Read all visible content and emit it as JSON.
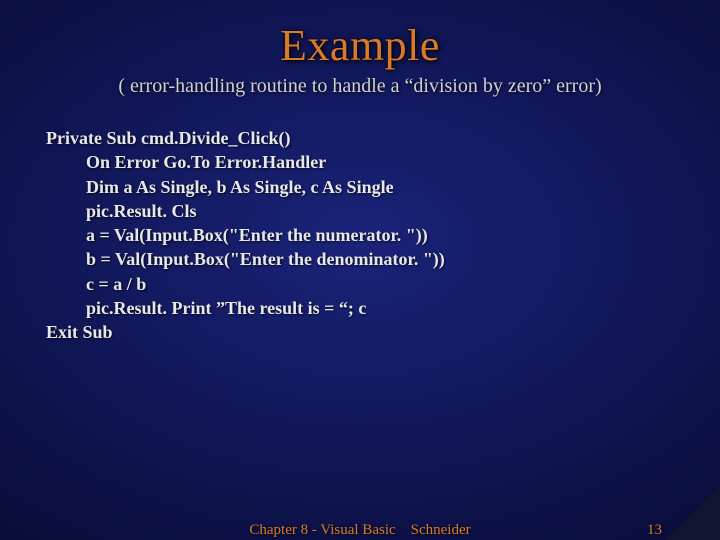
{
  "title": "Example",
  "subtitle": "( error-handling routine to handle a “division by zero” error)",
  "code": {
    "l0": "Private Sub cmd.Divide_Click()",
    "l1": "On Error Go.To Error.Handler",
    "l2": "Dim a As Single, b As Single, c As Single",
    "l3": "pic.Result. Cls",
    "l4": "a = Val(Input.Box(\"Enter the numerator. \"))",
    "l5": "b = Val(Input.Box(\"Enter the denominator. \"))",
    "l6": "c = a / b",
    "l7": "pic.Result. Print ”The result is = “; c",
    "l8": "Exit Sub"
  },
  "footer": {
    "center": "Chapter 8 - Visual Basic    Schneider",
    "page": "13"
  }
}
